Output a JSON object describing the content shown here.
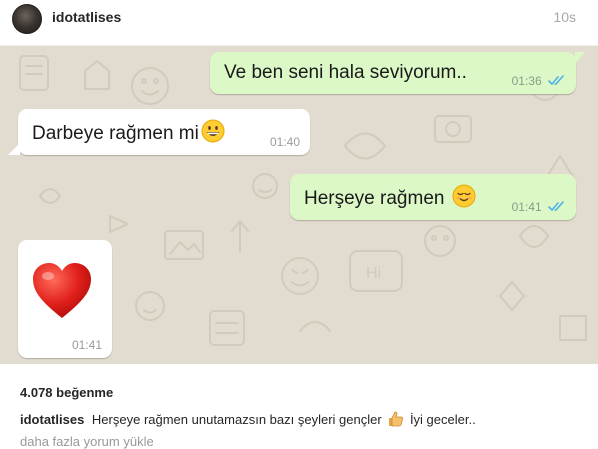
{
  "post": {
    "username": "idotatlises",
    "time_ago": "10s"
  },
  "chat": {
    "messages": [
      {
        "direction": "out",
        "text": "Ve ben seni hala seviyorum..",
        "time": "01:36",
        "read": true
      },
      {
        "direction": "in",
        "text": "Darbeye rağmen mi",
        "emoji": "grinning-face",
        "time": "01:40"
      },
      {
        "direction": "out",
        "text": "Herşeye rağmen",
        "emoji": "relieved-face",
        "time": "01:41",
        "read": true
      },
      {
        "direction": "in",
        "emoji": "red-heart",
        "time": "01:41"
      }
    ]
  },
  "footer": {
    "likes": "4.078 beğenme",
    "caption_user": "idotatlises",
    "caption_text_1": "Herşeye rağmen unutamazsın bazı şeyleri gençler",
    "caption_emoji": "thumbs-up",
    "caption_text_2": "İyi geceler..",
    "load_more": "daha fazla yorum yükle"
  },
  "colors": {
    "chat_background": "#e2dbcf",
    "outgoing_bubble": "#dcf8c6",
    "incoming_bubble": "#ffffff",
    "read_ticks": "#4fb3e8"
  }
}
